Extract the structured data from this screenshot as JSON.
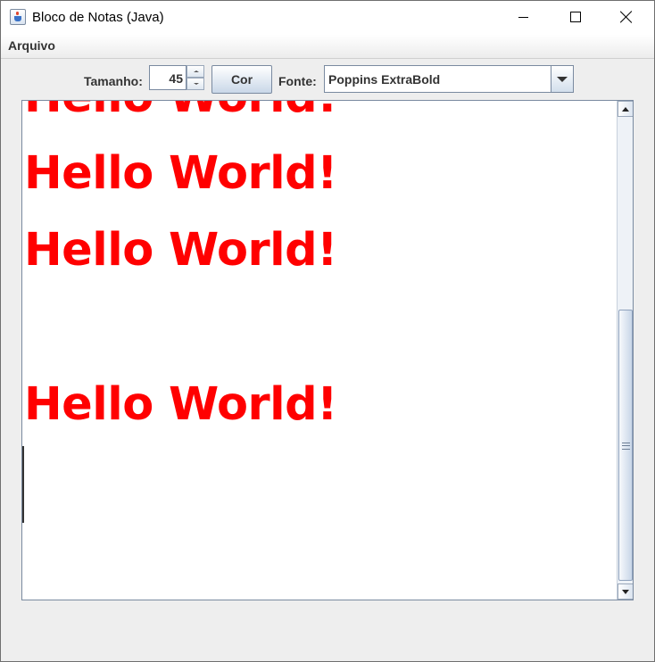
{
  "window": {
    "title": "Bloco de Notas (Java)"
  },
  "menu": {
    "items": [
      "Arquivo"
    ]
  },
  "toolbar": {
    "size_label": "Tamanho:",
    "size_value": "45",
    "color_button": "Cor",
    "font_label": "Fonte:",
    "font_selected": "Poppins ExtraBold"
  },
  "editor": {
    "text_color": "#ff0000",
    "lines": [
      "Hello World!",
      "Hello World!",
      "Hello World!",
      "",
      "Hello World!",
      ""
    ]
  },
  "icons": {
    "app": "java-app-icon",
    "minimize": "minimize-icon",
    "maximize": "maximize-icon",
    "close": "close-icon"
  }
}
